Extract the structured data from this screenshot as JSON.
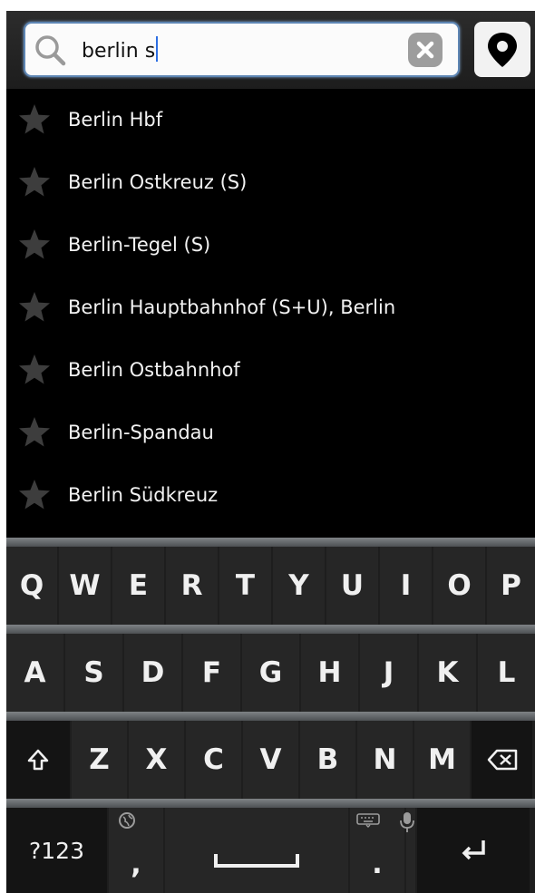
{
  "search": {
    "query": "berlin s",
    "icon": "search-icon",
    "clear_icon": "close-icon",
    "location_icon": "location-pin-icon",
    "accent": "#5e86b4"
  },
  "results": [
    {
      "label": "Berlin Hbf",
      "icon": "star-icon"
    },
    {
      "label": "Berlin Ostkreuz (S)",
      "icon": "star-icon"
    },
    {
      "label": "Berlin-Tegel (S)",
      "icon": "star-icon"
    },
    {
      "label": "Berlin Hauptbahnhof (S+U), Berlin",
      "icon": "star-icon"
    },
    {
      "label": "Berlin Ostbahnhof",
      "icon": "star-icon"
    },
    {
      "label": "Berlin-Spandau",
      "icon": "star-icon"
    },
    {
      "label": "Berlin Südkreuz",
      "icon": "star-icon"
    }
  ],
  "keyboard": {
    "row1": [
      "Q",
      "W",
      "E",
      "R",
      "T",
      "Y",
      "U",
      "I",
      "O",
      "P"
    ],
    "row2": [
      "A",
      "S",
      "D",
      "F",
      "G",
      "H",
      "J",
      "K",
      "L"
    ],
    "row3": [
      "Z",
      "X",
      "C",
      "V",
      "B",
      "N",
      "M"
    ],
    "shift_icon": "shift-icon",
    "backspace_icon": "backspace-icon",
    "symbols_label": "?123",
    "comma_label": ",",
    "period_label": ".",
    "globe_icon": "globe-icon",
    "keyboard_icon": "keyboard-icon",
    "mic_icon": "microphone-icon",
    "space_icon": "space-icon",
    "enter_icon": "enter-icon"
  }
}
